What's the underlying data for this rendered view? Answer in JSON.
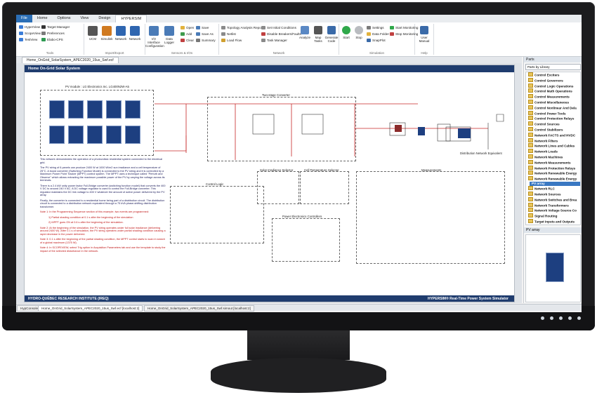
{
  "ribbon": {
    "tabs": [
      "File",
      "Home",
      "Options",
      "View",
      "Design",
      "HYPERSIM"
    ],
    "tools_group": {
      "label": "Tools",
      "items": [
        "HyperView",
        "ScopeView",
        "TestView"
      ],
      "items2": [
        "Target Manager",
        "Preferences",
        "Elabo-CPS"
      ]
    },
    "import_group": {
      "label": "Import/Export",
      "items": [
        "UCM",
        "Simulink",
        "Network",
        "Network"
      ]
    },
    "sensors_group": {
      "label": "Sensors & I/Os",
      "items": [
        "I/O Interface Configuration",
        "Data Logger"
      ],
      "items2": [
        "Open",
        "Add",
        "Clear"
      ],
      "items3": [
        "Save",
        "Save As",
        "Summary"
      ]
    },
    "network_group": {
      "label": "Network",
      "items": [
        "Topology Analysis Report",
        "Netlist",
        "Load Flow"
      ],
      "items2": [
        "Set Initial Conditions",
        "Disable Breakers/Faults",
        "Task Manager"
      ],
      "items3": [
        "Analyze",
        "Map Tasks",
        "Generate Code"
      ]
    },
    "simulation_group": {
      "label": "Simulation",
      "items": [
        "Start",
        "Stop"
      ],
      "items2": [
        "Settings",
        "Data Folder",
        "SnapPlot"
      ],
      "items3": [
        "Start Monitoring",
        "Stop Monitoring"
      ]
    },
    "help_group": {
      "label": "Help",
      "items": [
        "User Manual"
      ]
    }
  },
  "document": {
    "tab": "Home_OnGrid_SolarSystem_APEC2020_15us_Swf.ecf",
    "header_title": "Home On-Grid Solar System",
    "footer_left": "HYDRO-QUÉBEC RESEARCH INSTITUTE (IREQ)",
    "footer_right": "HYPERSIM® Real-Time Power System Simulator",
    "blocks": {
      "pv_module": "PV module : LG Electronics Inc. LG400N2W-A5",
      "two_stage": "Two-stage Converter",
      "dist_network": "Distribution Network Equivalent",
      "control_logic": "Control Logic",
      "solar_irr": "Solar Irradiance Selector",
      "cell_temp": "Cell Temperature Selector",
      "measurements": "Measurements",
      "pec": "Power Electronics Controllers"
    },
    "description": [
      "This network demonstrates the operation of a photovoltaic residential system connected to the electrical grid.",
      "The PV string of 6 panels can produce 2400 W at 1000 W/m2 sun irradiance and a cell temperature of 25°C. A boost converter (Switching Function Model) is connected to the PV string and it is controlled by a Maximum Power Point Tracker (MPPT) control system. The MPPT uses a technique called \"Perturb and Observe\" which allows extracting the maximum possible power of the PV by varying the voltage across its terminals.",
      "There is a 2.4 kW unity power factor Full-Bridge converter (switching function model) that converts the 400 V DC to around 240 V AC. A DC voltage regulator is used to control the Full-Bridge converter. This regulator maintains the DC link voltage to 400 V whatever the amount of active power delivered by the PV array.",
      "Finally, the converter is connected to a residential home being part of a distribution circuit. The distribution circuit is connected to a distribution network equivalent through a 75 kVA phase-shifting distribution transformer."
    ],
    "notes": [
      "Note 1: In the Programming Sequence section of this example, two events are programmed:",
      "1) Partial shading condition at 0.1 s after the beginning of the simulation",
      "2) MPPT goes ON at 0.6 s after the beginning of the simulation.",
      "Note 2: At the beginning of the simulation, the PV string operates under full solar irradiance (delivering around 2400 W). After 0.1 s of simulation, the PV string operates under partial shading condition causing a rapid decrease in the power delivered.",
      "Note 3: 0.1 s after the beginning of the partial shading condition, the MPPT control starts to scan in search of a global maximum (1375 W).",
      "Note 4: In SCOPEVIEW, select Trig option in Acquisition Parameters tab and use the template to study the impact of the selected disturbance in the network."
    ]
  },
  "parts_panel": {
    "title": "Parts",
    "dropdown": "Parts by Library",
    "items": [
      "Control Exciters",
      "Control Governors",
      "Control Logic Operations",
      "Control Math Operations",
      "Control Measurements",
      "Control Miscellaneous",
      "Control Nonlinear And Dela",
      "Control Power Tools",
      "Control Protection Relays",
      "Control Sources",
      "Control Stabilizers",
      "Network FACTS and HVDC",
      "Network Filters",
      "Network Lines and Cables",
      "Network Loads",
      "Network Machines",
      "Network Measurements",
      "Network Protection Relays",
      "Network Renewable Energy",
      "Network Renewable Energy",
      "PV array",
      "Network RLC",
      "Network Sources",
      "Network Switches and Brea",
      "Network Transformers",
      "Network Voltage Source Co",
      "Signal Routing",
      "Target Inputs and Outputs"
    ],
    "preview_title": "PV array"
  },
  "bottom_tabs": [
    "HypConsole",
    "Home_OnGrid_SolarSystem_APEC2020_15us_Swf.ecf [localhost:2]",
    "Home_OnGrid_SolarSystem_APEC2020_15us_Swf.simout [localhost:2]"
  ]
}
